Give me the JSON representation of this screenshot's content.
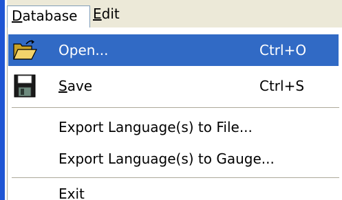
{
  "menubar": {
    "menus": [
      {
        "label_first": "D",
        "label_rest": "atabase",
        "active": true
      },
      {
        "label_first": "E",
        "label_rest": "dit",
        "active": false
      }
    ]
  },
  "dropdown": {
    "items": [
      {
        "label": "Open...",
        "shortcut": "Ctrl+O",
        "icon": "open-folder-icon",
        "highlighted": true
      },
      {
        "label_first": "S",
        "label_rest": "ave",
        "shortcut": "Ctrl+S",
        "icon": "floppy-disk-icon",
        "highlighted": false
      },
      {
        "label": "Export Language(s) to File..."
      },
      {
        "label": "Export Language(s) to Gauge..."
      },
      {
        "label": "Exit"
      }
    ]
  },
  "colors": {
    "highlight": "#316ac5",
    "menubar_bg": "#ece9d8",
    "window_edge": "#1f55d4"
  }
}
